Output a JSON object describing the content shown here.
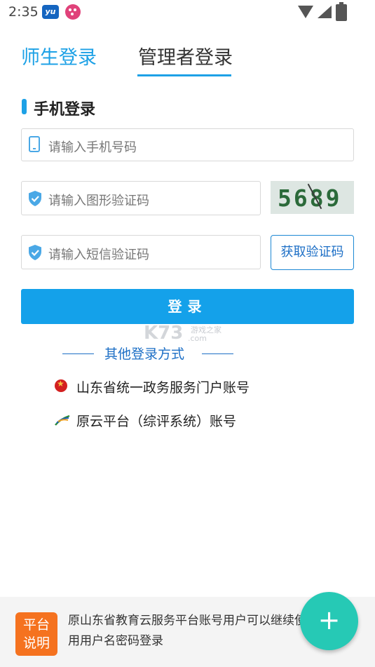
{
  "status_bar": {
    "time": "2:35",
    "app_icon_1_text": "yu"
  },
  "tabs": [
    {
      "label": "师生登录",
      "active": false
    },
    {
      "label": "管理者登录",
      "active": true
    }
  ],
  "section": {
    "title": "手机登录"
  },
  "form": {
    "phone_placeholder": "请输入手机号码",
    "image_code_placeholder": "请输入图形验证码",
    "captcha_text": "5689",
    "sms_code_placeholder": "请输入短信验证码",
    "sms_button_label": "获取验证码",
    "login_button_label": "登录"
  },
  "watermark": {
    "text": "K73",
    "sub": "游戏之家",
    "url": ".com"
  },
  "other_login": {
    "title": "其他登录方式",
    "options": [
      {
        "label": "山东省统一政务服务门户账号",
        "icon": "emblem-icon"
      },
      {
        "label": "原云平台（综评系统）账号",
        "icon": "yuanyun-icon"
      }
    ]
  },
  "bottom": {
    "badge_line1": "平台",
    "badge_line2": "说明",
    "notice": "原山东省教育云服务平台账号用户可以继续使用用户名密码登录",
    "fab_label": "+"
  },
  "colors": {
    "accent": "#14a1ea",
    "fab": "#26c9b5",
    "badge": "#f5721f"
  }
}
